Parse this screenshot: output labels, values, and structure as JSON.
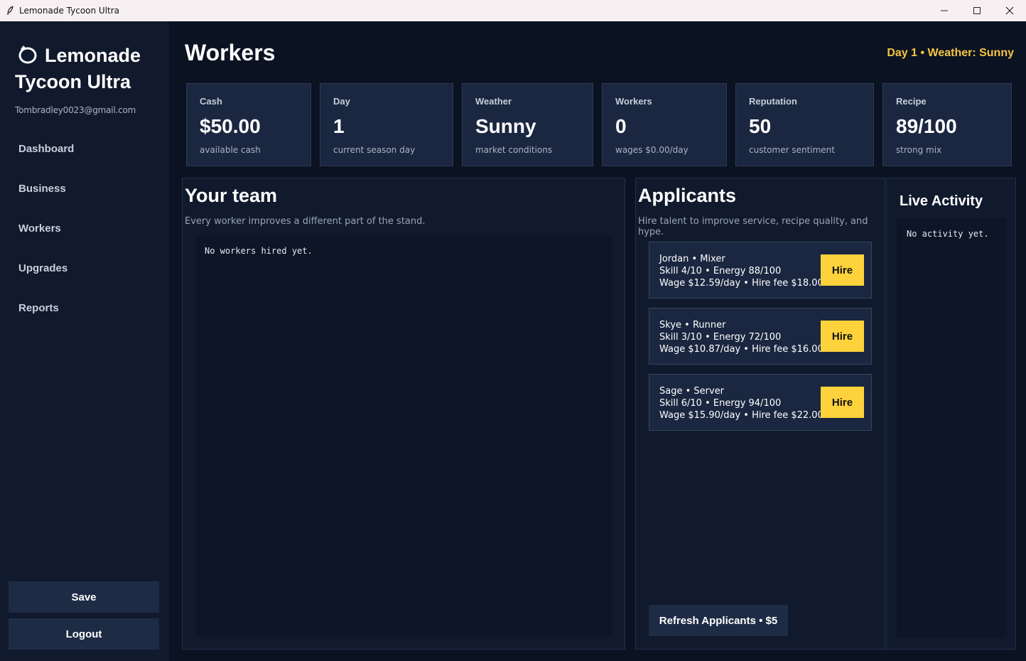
{
  "window": {
    "title": "Lemonade Tycoon Ultra",
    "icons": [
      "feather-icon",
      "minimize-icon",
      "maximize-icon",
      "close-icon"
    ]
  },
  "sidebar": {
    "brand_line1": "Lemonade",
    "brand_line2": "Tycoon Ultra",
    "brand_icon": "lemon-icon",
    "email": "Tombradley0023@gmail.com",
    "nav": [
      "Dashboard",
      "Business",
      "Workers",
      "Upgrades",
      "Reports"
    ],
    "save_label": "Save",
    "logout_label": "Logout"
  },
  "header": {
    "title": "Workers",
    "status": "Day 1 • Weather: Sunny"
  },
  "stats": [
    {
      "label": "Cash",
      "value": "$50.00",
      "sub": "available cash"
    },
    {
      "label": "Day",
      "value": "1",
      "sub": "current season day"
    },
    {
      "label": "Weather",
      "value": "Sunny",
      "sub": "market conditions"
    },
    {
      "label": "Workers",
      "value": "0",
      "sub": "wages $0.00/day"
    },
    {
      "label": "Reputation",
      "value": "50",
      "sub": "customer sentiment"
    },
    {
      "label": "Recipe",
      "value": "89/100",
      "sub": "strong mix"
    }
  ],
  "team": {
    "title": "Your team",
    "description": "Every worker improves a different part of the stand.",
    "empty_text": "No workers hired yet."
  },
  "applicants": {
    "title": "Applicants",
    "description": "Hire talent to improve service, recipe quality, and hype.",
    "items": [
      {
        "line1": "Jordan • Mixer",
        "line2": "Skill 4/10 • Energy 88/100",
        "line3": "Wage $12.59/day • Hire fee $18.00",
        "button": "Hire"
      },
      {
        "line1": "Skye • Runner",
        "line2": "Skill 3/10 • Energy 72/100",
        "line3": "Wage $10.87/day • Hire fee $16.00",
        "button": "Hire"
      },
      {
        "line1": "Sage • Server",
        "line2": "Skill 6/10 • Energy 94/100",
        "line3": "Wage $15.90/day • Hire fee $22.00",
        "button": "Hire"
      }
    ],
    "refresh_label": "Refresh Applicants • $5"
  },
  "activity": {
    "title": "Live Activity",
    "empty_text": "No activity yet."
  },
  "colors": {
    "background": "#0b1221",
    "sidebar": "#111a2c",
    "card": "#1b2740",
    "accent": "#f5c542",
    "hire_button": "#fdd23b",
    "button": "#1e2b45"
  }
}
